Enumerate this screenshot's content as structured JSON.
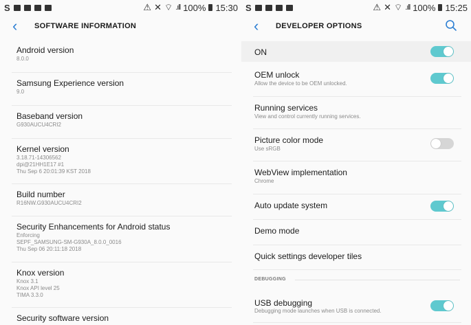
{
  "left_screen": {
    "status": {
      "carrier_logo": "S",
      "battery_pct": "100%",
      "time": "15:30"
    },
    "header": {
      "title": "SOFTWARE INFORMATION"
    },
    "items": [
      {
        "title": "Android version",
        "sub": [
          "8.0.0"
        ]
      },
      {
        "title": "Samsung Experience version",
        "sub": [
          "9.0"
        ]
      },
      {
        "title": "Baseband version",
        "sub": [
          "G930AUCU4CRI2"
        ]
      },
      {
        "title": "Kernel version",
        "sub": [
          "3.18.71-14306562",
          "dpi@21HH1E17 #1",
          "Thu Sep 6 20:01:39 KST 2018"
        ]
      },
      {
        "title": "Build number",
        "sub": [
          "R16NW.G930AUCU4CRI2"
        ]
      },
      {
        "title": "Security Enhancements for Android status",
        "sub": [
          "Enforcing",
          "SEPF_SAMSUNG-SM-G930A_8.0.0_0016",
          "Thu Sep 06 20:11:18 2018"
        ]
      },
      {
        "title": "Knox version",
        "sub": [
          "Knox 3.1",
          "Knox API level 25",
          "TIMA 3.3.0"
        ]
      },
      {
        "title": "Security software version",
        "sub": []
      }
    ]
  },
  "right_screen": {
    "status": {
      "carrier_logo": "S",
      "battery_pct": "100%",
      "time": "15:25"
    },
    "header": {
      "title": "DEVELOPER OPTIONS"
    },
    "master": {
      "label": "ON",
      "state": "on"
    },
    "items": [
      {
        "title": "OEM unlock",
        "sub": "Allow the device to be OEM unlocked.",
        "toggle": "on"
      },
      {
        "title": "Running services",
        "sub": "View and control currently running services."
      },
      {
        "title": "Picture color mode",
        "sub": "Use sRGB",
        "toggle": "off"
      },
      {
        "title": "WebView implementation",
        "sub": "Chrome"
      },
      {
        "title": "Auto update system",
        "sub": "",
        "toggle": "on"
      },
      {
        "title": "Demo mode",
        "sub": ""
      },
      {
        "title": "Quick settings developer tiles",
        "sub": ""
      }
    ],
    "section": "DEBUGGING",
    "usb": {
      "title": "USB debugging",
      "sub": "Debugging mode launches when USB is connected.",
      "toggle": "on"
    }
  },
  "colors": {
    "accent": "#2d7fd3",
    "toggle_on": "#5fc9cf",
    "toggle_off": "#d6d6d6"
  },
  "icons": [
    "back-arrow-icon",
    "search-icon",
    "wifi-icon",
    "signal-icon",
    "battery-icon",
    "mute-icon",
    "bluetooth-icon"
  ]
}
